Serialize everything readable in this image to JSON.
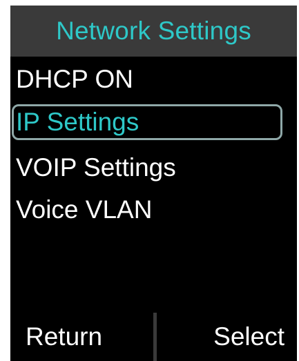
{
  "header": {
    "title": "Network Settings"
  },
  "menu": {
    "items": [
      {
        "label": "DHCP ON"
      },
      {
        "label": "IP Settings",
        "selected": true
      },
      {
        "label": "VOIP Settings"
      },
      {
        "label": "Voice VLAN"
      }
    ]
  },
  "softkeys": {
    "left_label": "Return",
    "right_label": "Select"
  },
  "colors": {
    "accent": "#2ec8c8",
    "bar_background": "#3a3a3a",
    "screen_background": "#000000",
    "selection_border": "#8fa8a8",
    "text": "#ffffff"
  }
}
